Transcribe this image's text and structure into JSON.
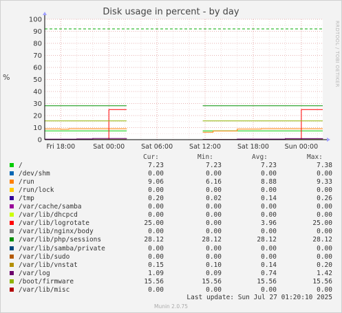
{
  "chart": {
    "title": "Disk usage in percent - by day",
    "ylabel": "%",
    "watermark": "RRDTOOL / TOBI OETIKER",
    "version": "Munin 2.0.75",
    "last_update": "Last update: Sun Jul 27 01:20:10 2025"
  },
  "legend_headers": {
    "cur": "Cur:",
    "min": "Min:",
    "avg": "Avg:",
    "max": "Max:"
  },
  "colors": {
    "plot_bg": "#ffffff",
    "grid_major": "#e7b0b0",
    "grid_minor": "#f2dede",
    "axis": "#000000"
  },
  "chart_data": {
    "type": "line",
    "ylim": [
      0,
      100
    ],
    "yticks": [
      0,
      10,
      20,
      30,
      40,
      50,
      60,
      70,
      80,
      90,
      100
    ],
    "xlim_hours": [
      0,
      34.67
    ],
    "xticks": [
      {
        "label": "Fri 18:00",
        "hour": 2
      },
      {
        "label": "Sat 00:00",
        "hour": 8
      },
      {
        "label": "Sat 06:00",
        "hour": 14
      },
      {
        "label": "Sat 12:00",
        "hour": 20
      },
      {
        "label": "Sat 18:00",
        "hour": 26
      },
      {
        "label": "Sun 00:00",
        "hour": 32
      }
    ],
    "warning_line": {
      "value": 92,
      "color": "#00aa00"
    },
    "gap_hours": [
      10.2,
      19.7
    ],
    "series": [
      {
        "name": "/",
        "color": "#00cc00",
        "cur": "7.23",
        "min": "7.23",
        "avg": "7.23",
        "max": "7.38",
        "points": [
          [
            0,
            7.3
          ],
          [
            10.2,
            7.25
          ],
          [
            19.7,
            7.25
          ],
          [
            34.67,
            7.23
          ]
        ]
      },
      {
        "name": "/dev/shm",
        "color": "#0066b3",
        "cur": "0.00",
        "min": "0.00",
        "avg": "0.00",
        "max": "0.00",
        "points": [
          [
            0,
            0
          ],
          [
            10.2,
            0
          ],
          [
            19.7,
            0
          ],
          [
            34.67,
            0
          ]
        ]
      },
      {
        "name": "/run",
        "color": "#ff8000",
        "cur": "9.06",
        "min": "6.16",
        "avg": "8.88",
        "max": "9.33",
        "points": [
          [
            0,
            8.9
          ],
          [
            2,
            8.6
          ],
          [
            3,
            9.1
          ],
          [
            10.2,
            9.2
          ],
          [
            19.7,
            6.2
          ],
          [
            21,
            7.2
          ],
          [
            24,
            8.8
          ],
          [
            27,
            9.1
          ],
          [
            34.67,
            9.06
          ]
        ]
      },
      {
        "name": "/run/lock",
        "color": "#ffcc00",
        "cur": "0.00",
        "min": "0.00",
        "avg": "0.00",
        "max": "0.00",
        "points": [
          [
            0,
            0
          ],
          [
            10.2,
            0
          ],
          [
            19.7,
            0
          ],
          [
            34.67,
            0
          ]
        ]
      },
      {
        "name": "/tmp",
        "color": "#330099",
        "cur": "0.20",
        "min": "0.02",
        "avg": "0.14",
        "max": "0.26",
        "points": [
          [
            0,
            0.1
          ],
          [
            10.2,
            0.2
          ],
          [
            19.7,
            0.1
          ],
          [
            34.67,
            0.2
          ]
        ]
      },
      {
        "name": "/var/cache/samba",
        "color": "#990099",
        "cur": "0.00",
        "min": "0.00",
        "avg": "0.00",
        "max": "0.00",
        "points": [
          [
            0,
            0
          ],
          [
            10.2,
            0
          ],
          [
            19.7,
            0
          ],
          [
            34.67,
            0
          ]
        ]
      },
      {
        "name": "/var/lib/dhcpcd",
        "color": "#ccff00",
        "cur": "0.00",
        "min": "0.00",
        "avg": "0.00",
        "max": "0.00",
        "points": [
          [
            0,
            0
          ],
          [
            10.2,
            0
          ],
          [
            19.7,
            0
          ],
          [
            34.67,
            0
          ]
        ]
      },
      {
        "name": "/var/lib/logrotate",
        "color": "#ff0000",
        "cur": "25.00",
        "min": "0.00",
        "avg": "3.96",
        "max": "25.00",
        "points": [
          [
            0,
            0
          ],
          [
            7.9,
            0
          ],
          [
            8,
            25
          ],
          [
            10.2,
            25
          ],
          [
            19.7,
            0
          ],
          [
            31.9,
            0
          ],
          [
            32,
            25
          ],
          [
            34.67,
            25
          ]
        ]
      },
      {
        "name": "/var/lib/nginx/body",
        "color": "#808080",
        "cur": "0.00",
        "min": "0.00",
        "avg": "0.00",
        "max": "0.00",
        "points": [
          [
            0,
            0
          ],
          [
            10.2,
            0
          ],
          [
            19.7,
            0
          ],
          [
            34.67,
            0
          ]
        ]
      },
      {
        "name": "/var/lib/php/sessions",
        "color": "#008f00",
        "cur": "28.12",
        "min": "28.12",
        "avg": "28.12",
        "max": "28.12",
        "points": [
          [
            0,
            28.12
          ],
          [
            10.2,
            28.12
          ],
          [
            19.7,
            28.12
          ],
          [
            34.67,
            28.12
          ]
        ]
      },
      {
        "name": "/var/lib/samba/private",
        "color": "#00487d",
        "cur": "0.00",
        "min": "0.00",
        "avg": "0.00",
        "max": "0.00",
        "points": [
          [
            0,
            0
          ],
          [
            10.2,
            0
          ],
          [
            19.7,
            0
          ],
          [
            34.67,
            0
          ]
        ]
      },
      {
        "name": "/var/lib/sudo",
        "color": "#b35a00",
        "cur": "0.00",
        "min": "0.00",
        "avg": "0.00",
        "max": "0.00",
        "points": [
          [
            0,
            0
          ],
          [
            10.2,
            0
          ],
          [
            19.7,
            0
          ],
          [
            34.67,
            0
          ]
        ]
      },
      {
        "name": "/var/lib/vnstat",
        "color": "#b38f00",
        "cur": "0.15",
        "min": "0.10",
        "avg": "0.14",
        "max": "0.20",
        "points": [
          [
            0,
            0.15
          ],
          [
            10.2,
            0.15
          ],
          [
            19.7,
            0.1
          ],
          [
            34.67,
            0.15
          ]
        ]
      },
      {
        "name": "/var/log",
        "color": "#6b006b",
        "cur": "1.09",
        "min": "0.09",
        "avg": "0.74",
        "max": "1.42",
        "points": [
          [
            0,
            0.4
          ],
          [
            4,
            0.6
          ],
          [
            6,
            1.0
          ],
          [
            10.2,
            1.2
          ],
          [
            19.7,
            0.1
          ],
          [
            24,
            0.5
          ],
          [
            30,
            0.9
          ],
          [
            34.67,
            1.09
          ]
        ]
      },
      {
        "name": "/boot/firmware",
        "color": "#8fb300",
        "cur": "15.56",
        "min": "15.56",
        "avg": "15.56",
        "max": "15.56",
        "points": [
          [
            0,
            15.56
          ],
          [
            10.2,
            15.56
          ],
          [
            19.7,
            15.56
          ],
          [
            34.67,
            15.56
          ]
        ]
      },
      {
        "name": "/var/lib/misc",
        "color": "#b30000",
        "cur": "0.00",
        "min": "0.00",
        "avg": "0.00",
        "max": "0.00",
        "points": [
          [
            0,
            0
          ],
          [
            10.2,
            0
          ],
          [
            19.7,
            0
          ],
          [
            34.67,
            0
          ]
        ]
      }
    ]
  }
}
